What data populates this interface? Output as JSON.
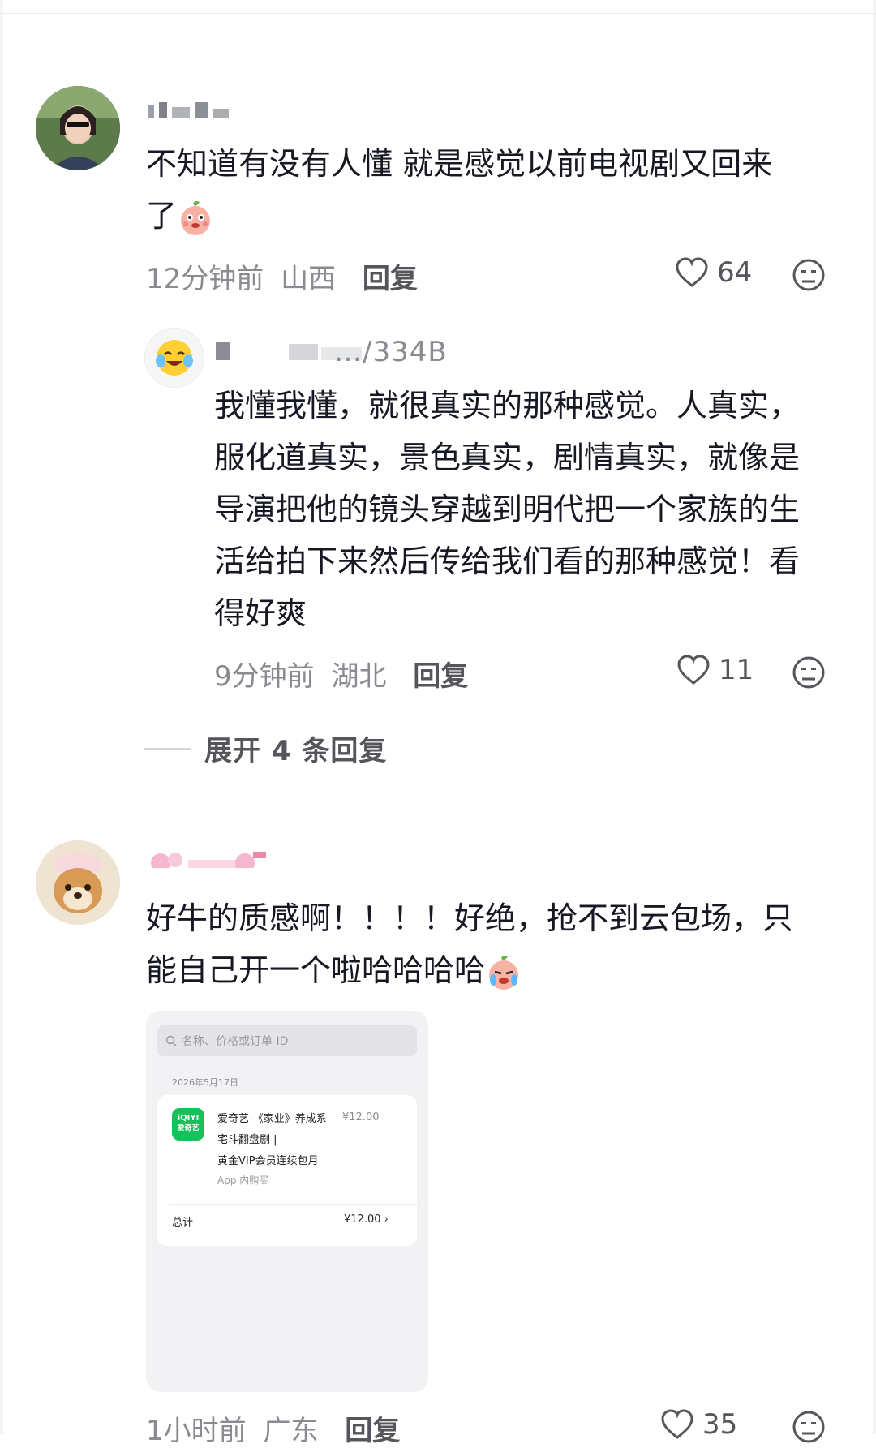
{
  "comments": [
    {
      "username": "",
      "text_line1": "不知道有没有人懂 就是感觉以前电视剧又回来",
      "text_line2": "了",
      "time": "12分钟前",
      "location": "山西",
      "reply_label": "回复",
      "likes": "64"
    },
    {
      "username": "",
      "text_line1": "好牛的质感啊！！！！好绝，抢不到云包场，只",
      "text_line2": "能自己开一个啦哈哈哈哈",
      "time": "1小时前",
      "location": "广东",
      "reply_label": "回复",
      "likes": "35"
    }
  ],
  "reply": {
    "username": "…/334B",
    "lines": [
      "我懂我懂，就很真实的那种感觉。人真实，",
      "服化道真实，景色真实，剧情真实，就像是",
      "导演把他的镜头穿越到明代把一个家族的生",
      "活给拍下来然后传给我们看的那种感觉！看",
      "得好爽"
    ],
    "time": "9分钟前",
    "location": "湖北",
    "reply_label": "回复",
    "likes": "11"
  },
  "expand_label": "展开 4 条回复",
  "order_screenshot": {
    "search_placeholder": "名称、价格或订单 ID",
    "date": "2026年5月17日",
    "app_icon_top": "iQIYI",
    "app_icon_bottom": "爱奇艺",
    "product_line1": "爱奇艺-《家业》养成系",
    "product_line2": "宅斗翻盘剧 |",
    "product_line3": "黄金VIP会员连续包月",
    "price": "¥12.00",
    "in_app": "App 内购买",
    "total_label": "总计",
    "total_value": "¥12.00 ›"
  },
  "colors": {
    "text_primary": "#161823",
    "text_secondary": "#8a8b91",
    "accent_green": "#14c15a"
  },
  "icons": {
    "like": "heart-icon",
    "dislike": "sad-face-icon",
    "search": "search-icon"
  }
}
